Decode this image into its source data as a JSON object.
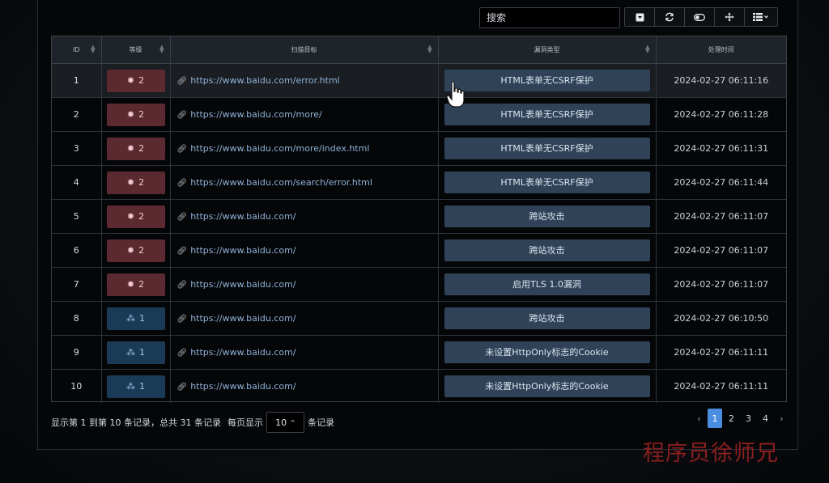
{
  "toolbar": {
    "search_placeholder": "搜索",
    "icons": [
      "dropdown-icon",
      "refresh-icon",
      "toggle-icon",
      "fullscreen-icon",
      "columns-icon"
    ]
  },
  "table": {
    "headers": [
      "ID",
      "等级",
      "扫描目标",
      "漏洞类型",
      "处理时间"
    ],
    "rows": [
      {
        "id": "1",
        "level": "2",
        "level_type": "high",
        "target": "https://www.baidu.com/error.html",
        "vuln": "HTML表单无CSRF保护",
        "time": "2024-02-27 06:11:16"
      },
      {
        "id": "2",
        "level": "2",
        "level_type": "high",
        "target": "https://www.baidu.com/more/",
        "vuln": "HTML表单无CSRF保护",
        "time": "2024-02-27 06:11:28"
      },
      {
        "id": "3",
        "level": "2",
        "level_type": "high",
        "target": "https://www.baidu.com/more/index.html",
        "vuln": "HTML表单无CSRF保护",
        "time": "2024-02-27 06:11:31"
      },
      {
        "id": "4",
        "level": "2",
        "level_type": "high",
        "target": "https://www.baidu.com/search/error.html",
        "vuln": "HTML表单无CSRF保护",
        "time": "2024-02-27 06:11:44"
      },
      {
        "id": "5",
        "level": "2",
        "level_type": "high",
        "target": "https://www.baidu.com/",
        "vuln": "跨站攻击",
        "time": "2024-02-27 06:11:07"
      },
      {
        "id": "6",
        "level": "2",
        "level_type": "high",
        "target": "https://www.baidu.com/",
        "vuln": "跨站攻击",
        "time": "2024-02-27 06:11:07"
      },
      {
        "id": "7",
        "level": "2",
        "level_type": "high",
        "target": "https://www.baidu.com/",
        "vuln": "启用TLS 1.0漏洞",
        "time": "2024-02-27 06:11:07"
      },
      {
        "id": "8",
        "level": "1",
        "level_type": "low",
        "target": "https://www.baidu.com/",
        "vuln": "跨站攻击",
        "time": "2024-02-27 06:10:50"
      },
      {
        "id": "9",
        "level": "1",
        "level_type": "low",
        "target": "https://www.baidu.com/",
        "vuln": "未设置HttpOnly标志的Cookie",
        "time": "2024-02-27 06:11:11"
      },
      {
        "id": "10",
        "level": "1",
        "level_type": "low",
        "target": "https://www.baidu.com/",
        "vuln": "未设置HttpOnly标志的Cookie",
        "time": "2024-02-27 06:11:11"
      }
    ]
  },
  "footer": {
    "summary": "显示第 1 到第 10 条记录，总共 31 条记录",
    "per_page_prefix": "每页显示",
    "per_page_value": "10",
    "per_page_suffix": "条记录"
  },
  "pagination": {
    "prev": "‹",
    "next": "›",
    "pages": [
      "1",
      "2",
      "3",
      "4"
    ],
    "current": "1"
  },
  "watermark": "程序员徐师兄",
  "colors": {
    "high_badge": "#5b2a31",
    "low_badge": "#1b3a55",
    "vuln_button": "#2f4257",
    "active_page": "#4a8ee0",
    "watermark": "#8b1f1f"
  }
}
